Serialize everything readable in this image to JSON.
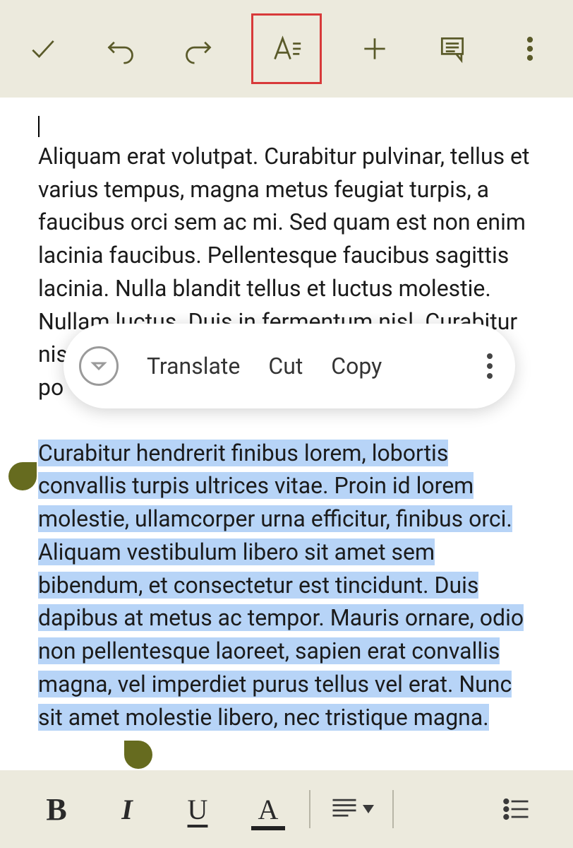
{
  "toolbar_top": {
    "confirm": "check-icon",
    "undo": "undo-icon",
    "redo": "redo-icon",
    "format": "text-format-icon",
    "insert": "plus-icon",
    "comment": "comment-icon",
    "overflow": "more-vert-icon"
  },
  "context_menu": {
    "translate": "Translate",
    "cut": "Cut",
    "copy": "Copy"
  },
  "document": {
    "para1": "Aliquam erat volutpat. Curabitur pulvinar, tellus et varius tempus, magna metus feugiat turpis, a faucibus orci sem ac mi. Sed quam est non enim lacinia faucibus. Pellentesque faucibus sagittis lacinia. Nulla blandit tellus et luctus molestie. Nullam luctus. Duis in fermentum nisl. Curabitur nisl elit, tincidunt eu tristique ut, co",
    "para1b": "po",
    "para2": "Curabitur hendrerit finibus lorem, lobortis convallis turpis ultrices vitae. Proin id lorem molestie, ullamcorper urna efficitur, finibus orci. Aliquam vestibulum libero sit amet sem bibendum, et consectetur est tincidunt. Duis dapibus at metus ac tempor. Mauris ornare, odio non pellentesque laoreet, sapien erat convallis magna, vel imperdiet purus tellus vel erat. Nunc sit amet molestie libero, nec tristique magna."
  },
  "toolbar_bottom": {
    "bold": "B",
    "italic": "I",
    "underline": "U",
    "textcolor": "A"
  }
}
